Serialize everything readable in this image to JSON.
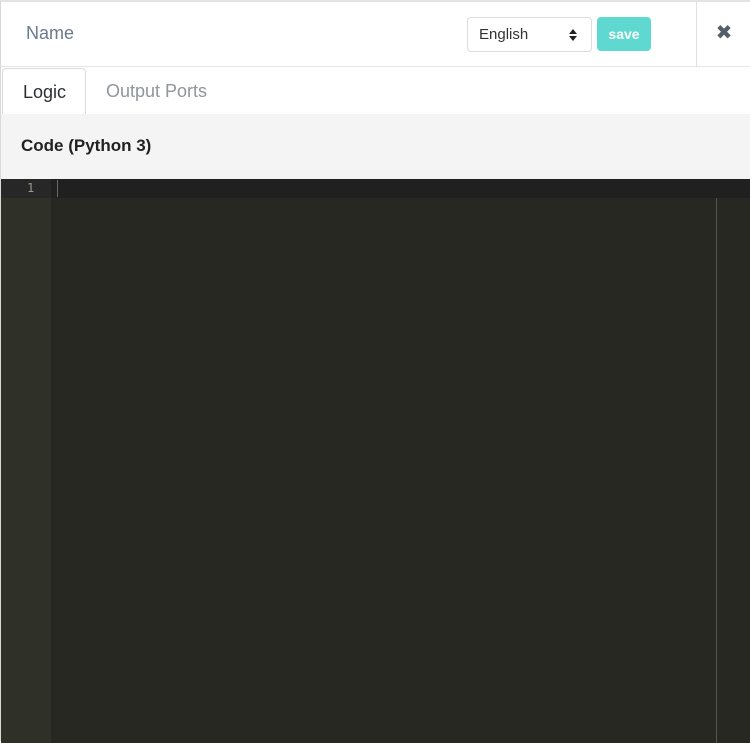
{
  "header": {
    "name_label": "Name",
    "language_select": {
      "selected": "English"
    },
    "save_label": "save",
    "close_glyph": "✖"
  },
  "tabs": [
    {
      "label": "Logic",
      "active": true
    },
    {
      "label": "Output Ports",
      "active": false
    }
  ],
  "section": {
    "title": "Code (Python 3)"
  },
  "editor": {
    "line_numbers": [
      "1"
    ],
    "content": ""
  },
  "colors": {
    "accent": "#5fd9cf",
    "editor_bg": "#272822",
    "gutter_bg": "#2f3129"
  },
  "icons": {
    "close": "close-icon",
    "select_arrows": "sort-arrows-icon"
  }
}
